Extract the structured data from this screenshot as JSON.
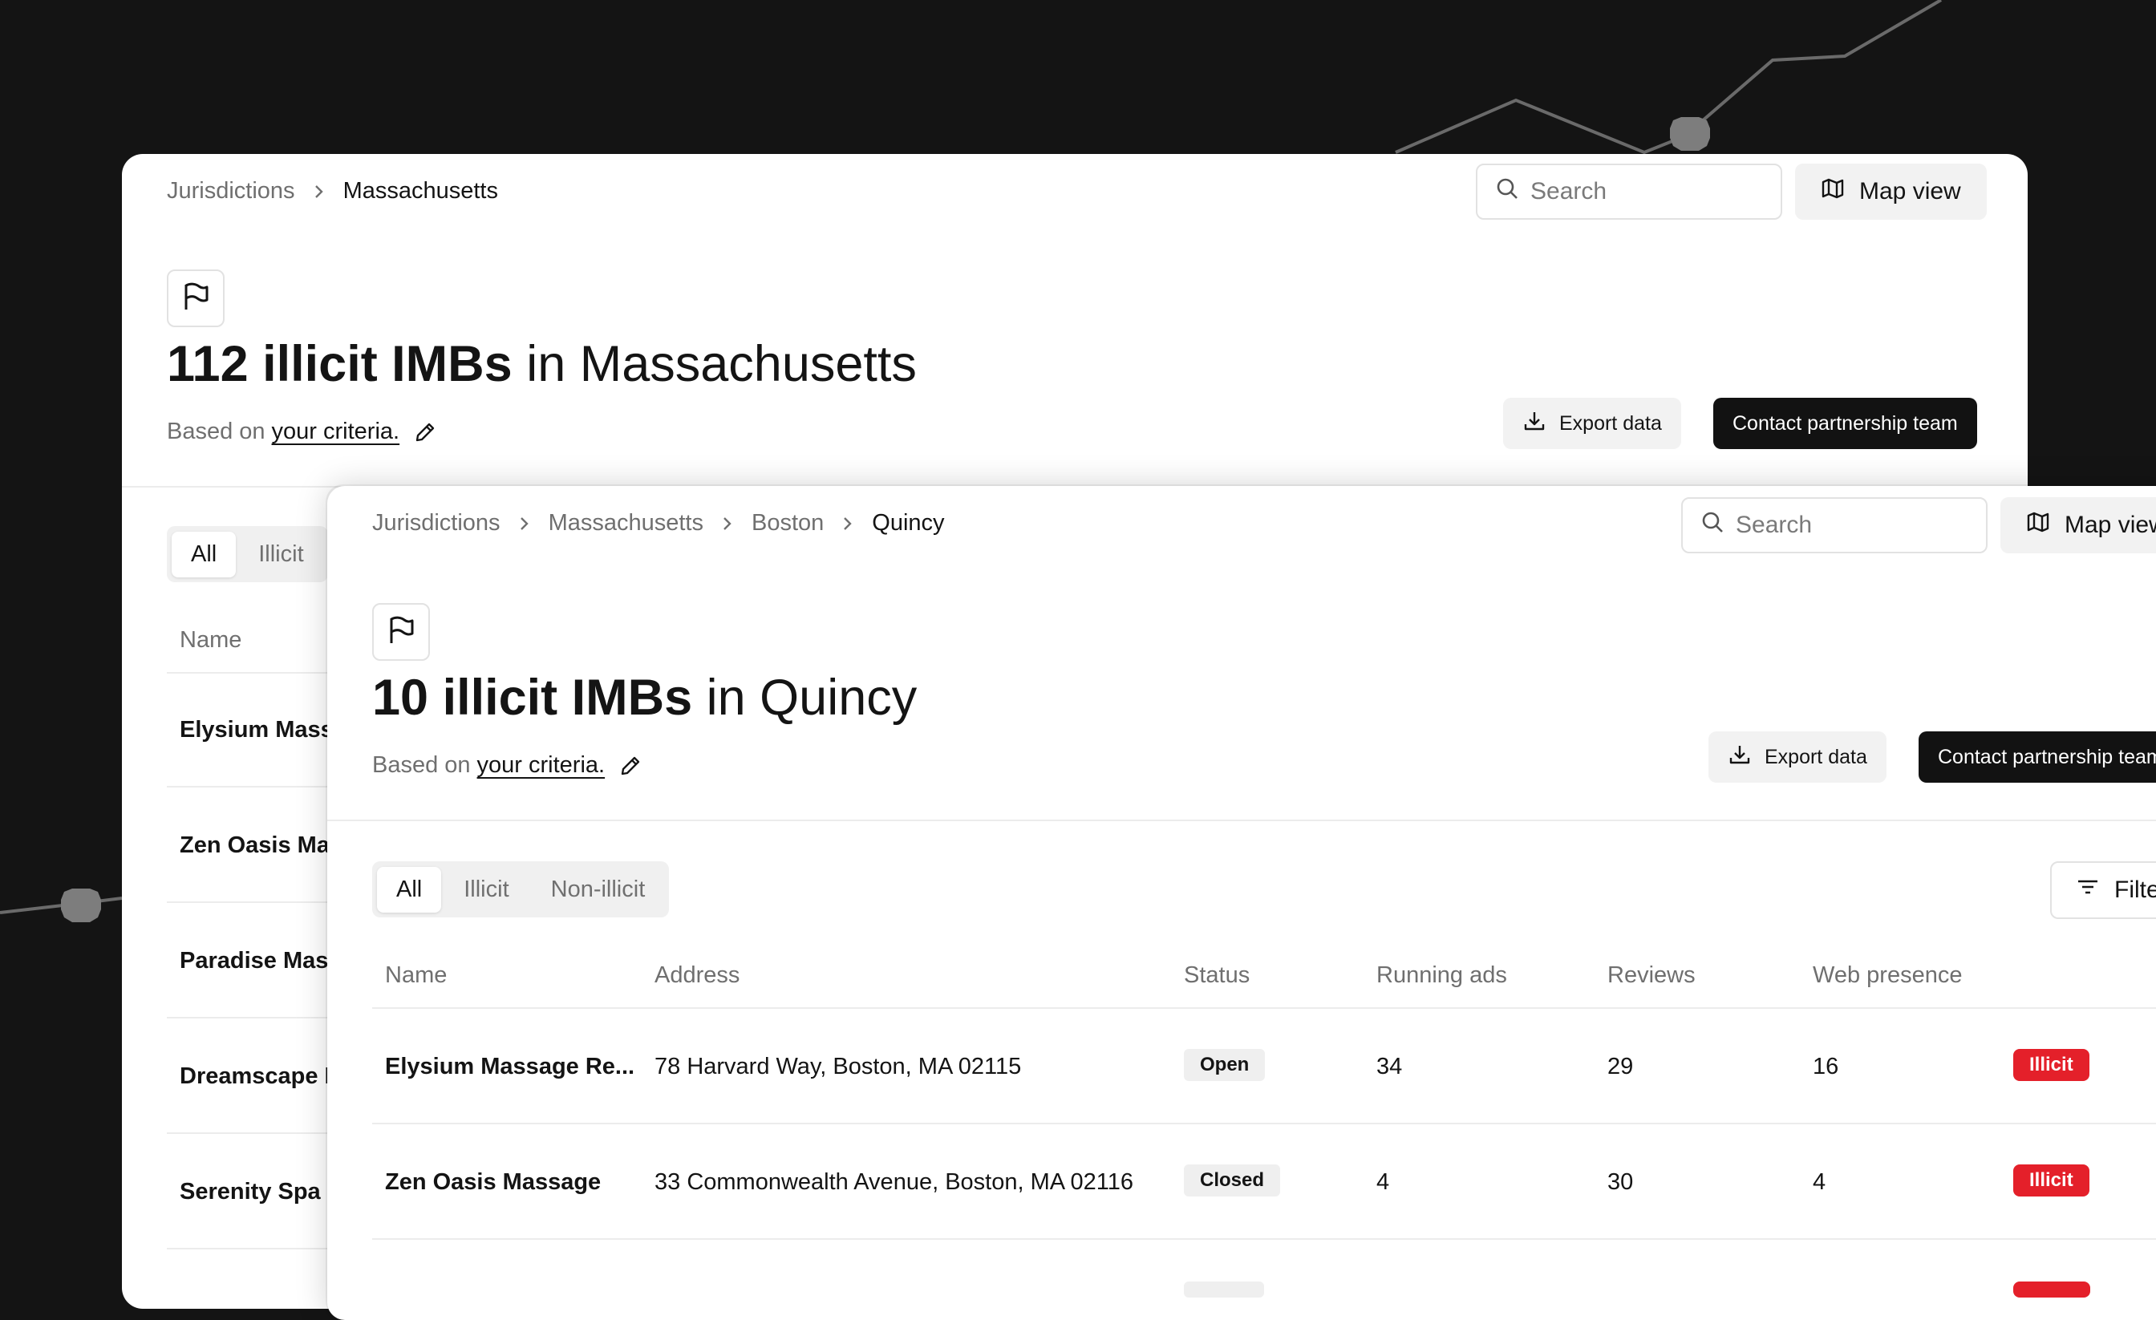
{
  "colors": {
    "background": "#141414",
    "accent_dark": "#121212",
    "illicit_red": "#e4202a"
  },
  "back_panel": {
    "breadcrumb": [
      "Jurisdictions",
      "Massachusetts"
    ],
    "search_placeholder": "Search",
    "map_view_label": "Map view",
    "title_bold": "112 illicit IMBs",
    "title_rest": " in Massachusetts",
    "criteria_prefix": "Based on",
    "criteria_link": "your criteria.",
    "export_label": "Export data",
    "contact_label": "Contact partnership team",
    "tabs": [
      "All",
      "Illicit"
    ],
    "name_header": "Name",
    "names": [
      "Elysium Massage",
      "Zen Oasis Massage",
      "Paradise Massage",
      "Dreamscape Massage",
      "Serenity Spa"
    ]
  },
  "front_panel": {
    "breadcrumb": [
      "Jurisdictions",
      "Massachusetts",
      "Boston",
      "Quincy"
    ],
    "search_placeholder": "Search",
    "map_view_label": "Map view",
    "title_bold": "10 illicit IMBs",
    "title_rest": " in Quincy",
    "criteria_prefix": "Based on",
    "criteria_link": "your criteria.",
    "export_label": "Export data",
    "contact_label": "Contact partnership team",
    "tabs": [
      "All",
      "Illicit",
      "Non-illicit"
    ],
    "filters_label": "Filters",
    "columns": [
      "Name",
      "Address",
      "Status",
      "Running ads",
      "Reviews",
      "Web presence"
    ],
    "rows": [
      {
        "name": "Elysium Massage Re...",
        "address": "78 Harvard Way, Boston, MA 02115",
        "status": "Open",
        "running_ads": "34",
        "reviews": "29",
        "web_presence": "16",
        "tag": "Illicit"
      },
      {
        "name": "Zen Oasis Massage",
        "address": "33 Commonwealth Avenue, Boston, MA 02116",
        "status": "Closed",
        "running_ads": "4",
        "reviews": "30",
        "web_presence": "4",
        "tag": "Illicit"
      }
    ]
  }
}
